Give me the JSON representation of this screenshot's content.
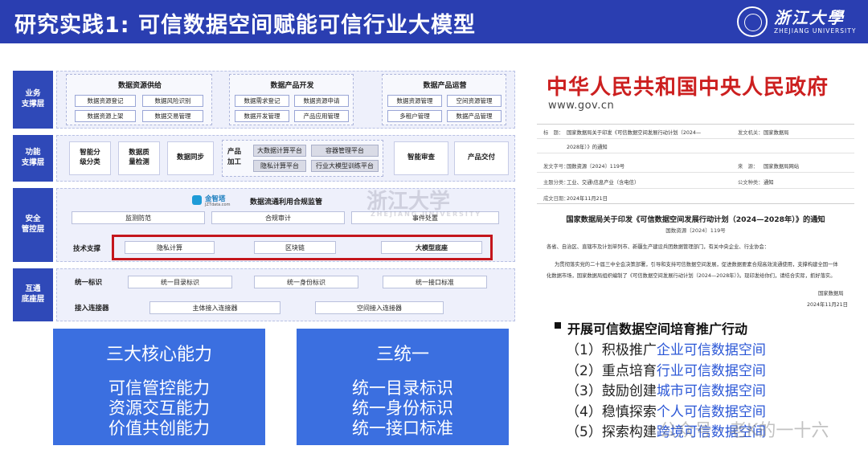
{
  "header": {
    "title": "研究实践1: 可信数据空间赋能可信行业大模型",
    "logo_cn": "浙江大學",
    "logo_en": "ZHEJIANG UNIVERSITY",
    "bg_color": "#2a3eb1"
  },
  "diagram": {
    "business": {
      "label": "业务\n支撑层",
      "groups": [
        {
          "title": "数据资源供给",
          "items": [
            "数据资源登记",
            "数据风险识别",
            "数据资源上架",
            "数据交易管理"
          ]
        },
        {
          "title": "数据产品开发",
          "items": [
            "数据需求登记",
            "数据资源申请",
            "数据开发管理",
            "产品应用管理"
          ]
        },
        {
          "title": "数据产品运营",
          "items": [
            "数据资源管理",
            "空间资源管理",
            "多租户管理",
            "数据产品管理"
          ]
        }
      ]
    },
    "function": {
      "label": "功能\n支撑层",
      "boxes": [
        "智能分\n级分类",
        "数据质\n量检测",
        "数据同步",
        "智能审查",
        "产品交付"
      ],
      "product_label": "产品\n加工",
      "product_items": [
        "大数据计算平台",
        "容器管理平台",
        "隐私计算平台",
        "行业大模型训练平台"
      ]
    },
    "security": {
      "label": "安全\n管控层",
      "brand": "金智塔",
      "brand_sub": "JZTdata.com",
      "title": "数据流通利用合规监管",
      "items": [
        "监测防范",
        "合规审计",
        "事件处置"
      ],
      "tech_label": "技术支撑",
      "tech_items": [
        "隐私计算",
        "区块链",
        "大模型底座"
      ]
    },
    "interop": {
      "label": "互通\n底座层",
      "row1_label": "统一标识",
      "row1_items": [
        "统一目录标识",
        "统一身份标识",
        "统一接口标准"
      ],
      "row2_label": "接入连接器",
      "row2_items": [
        "主体接入连接器",
        "空间接入连接器"
      ]
    },
    "watermark": "浙江大学",
    "watermark_en": "ZHEJIANG UNIVERSITY"
  },
  "capabilities": [
    {
      "title": "三大核心能力",
      "lines": [
        "可信管控能力",
        "资源交互能力",
        "价值共创能力"
      ]
    },
    {
      "title": "三统一",
      "lines": [
        "统一目录标识",
        "统一身份标识",
        "统一接口标准"
      ]
    }
  ],
  "gov_doc": {
    "site_title": "中华人民共和国中央人民政府",
    "site_url": "www.gov.cn",
    "meta": [
      {
        "k": "标　题：",
        "v": "国家数据局关于印发《可信数据空间发展行动计划（2024—",
        "k2": "发文机关：",
        "v2": "国家数据局"
      },
      {
        "k": "",
        "v": "2028年）》的通知",
        "k2": "",
        "v2": ""
      },
      {
        "k": "发文字号：",
        "v": "国数资源〔2024〕119号",
        "k2": "来　源：",
        "v2": "国家数据局网站"
      },
      {
        "k": "主题分类：",
        "v": "工业、交通\\信息产业（含电信）",
        "k2": "公文种类：",
        "v2": "通知"
      },
      {
        "k": "成文日期：",
        "v": "2024年11月21日",
        "k2": "",
        "v2": ""
      }
    ],
    "heading": "国家数据局关于印发《可信数据空间发展行动计划（2024—2028年）》的通知",
    "number": "国数资源〔2024〕119号",
    "greeting": "各省、自治区、直辖市及计划单列市、新疆生产建设兵团数据管理部门，有关中央企业、行业协会：",
    "body1": "为贯彻落实党的二十届三中全会决策部署，引导和支持可信数据空间发展，促进数据要素合规高效流通使用，支撑构建全国一体",
    "body2": "化数据市场，国家数据局组织编制了《可信数据空间发展行动计划（2024—2028年）》。现印发给你们，请结合实际，抓好落实。",
    "signer": "国家数据局",
    "date": "2024年11月21日"
  },
  "actions": {
    "heading": "开展可信数据空间培育推广行动",
    "items": [
      {
        "prefix": "（1）积极推广",
        "highlight": "企业可信数据空间"
      },
      {
        "prefix": "（2）重点培育",
        "highlight": "行业可信数据空间"
      },
      {
        "prefix": "（3）鼓励创建",
        "highlight": "城市可信数据空间"
      },
      {
        "prefix": "（4）稳慎探索",
        "highlight": "个人可信数据空间"
      },
      {
        "prefix": "（5）探索构建",
        "highlight": "跨境可信数据空间"
      }
    ],
    "highlight_color": "#2b57d6"
  },
  "bottom_watermark": "公众号 · 老K的一十六"
}
